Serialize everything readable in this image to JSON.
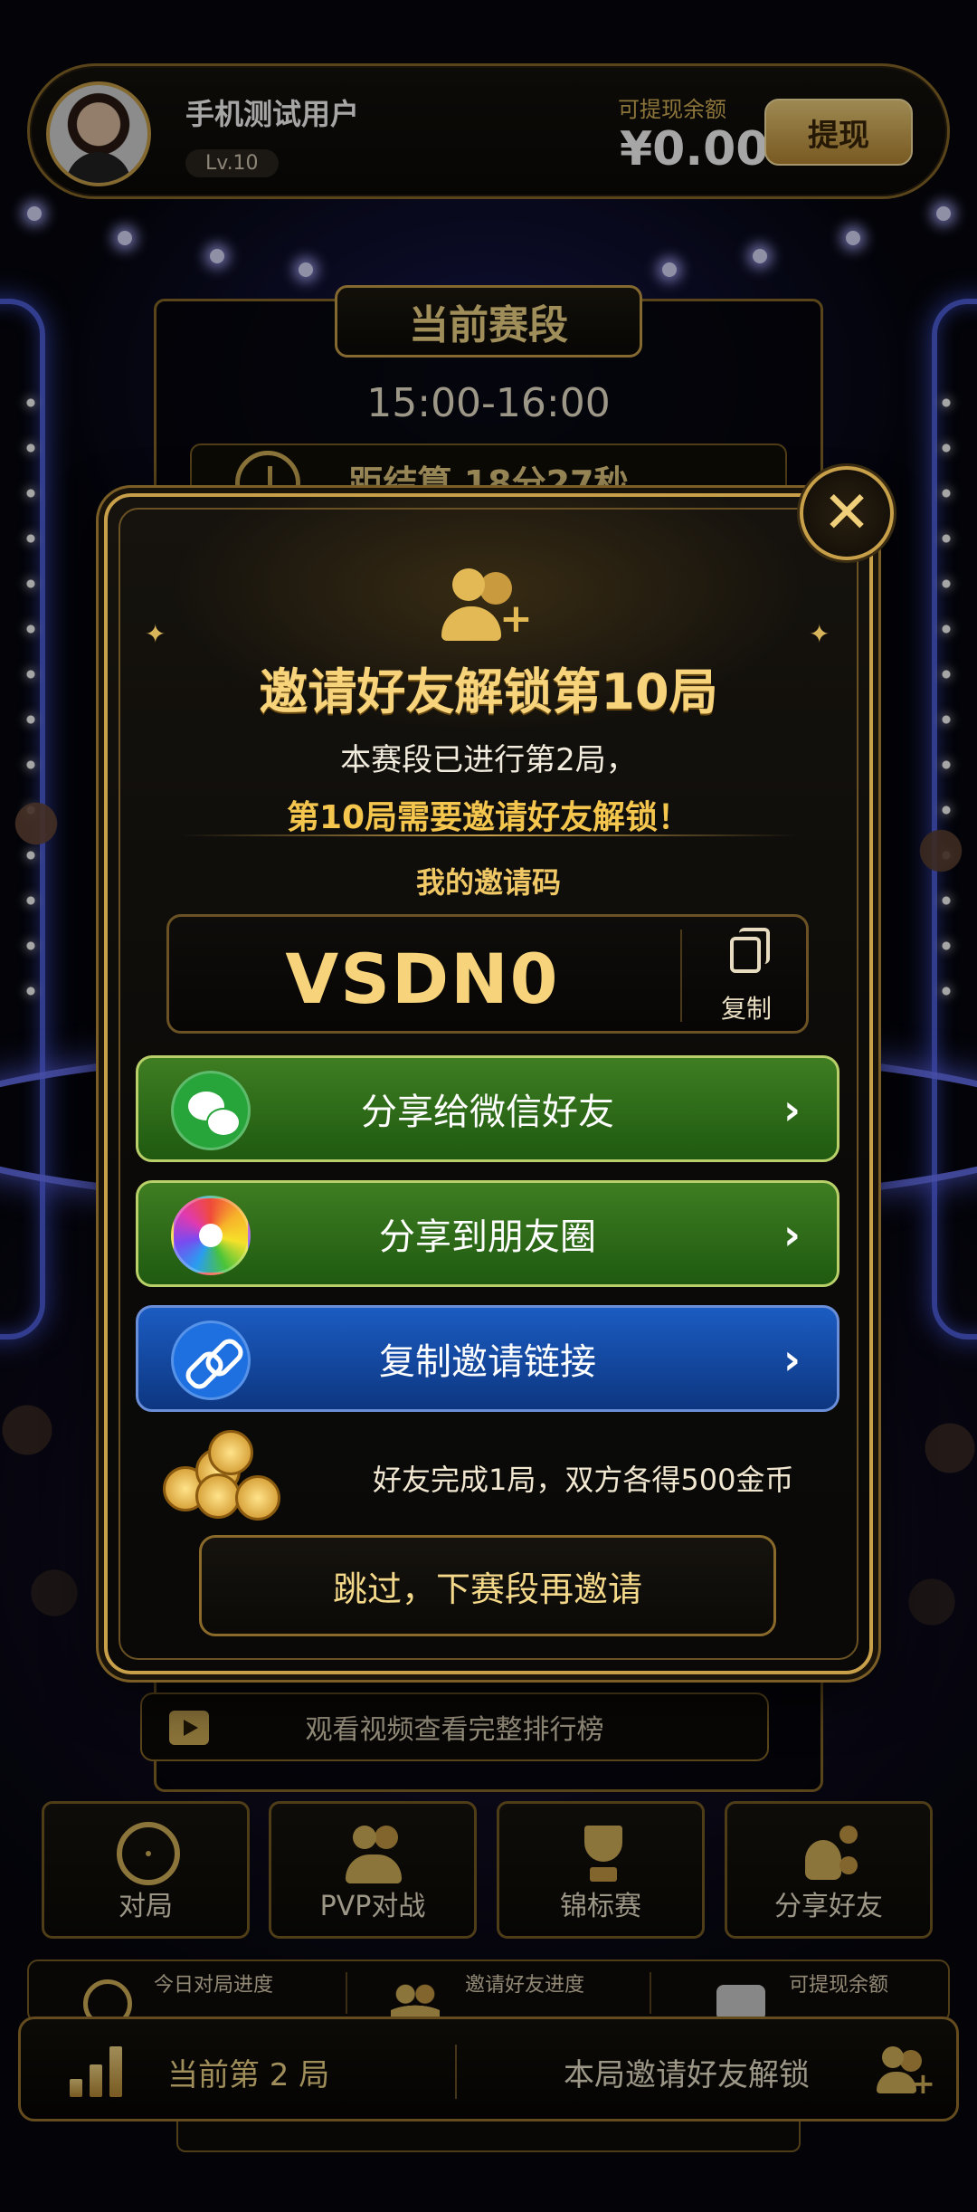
{
  "user": {
    "name": "手机测试用户",
    "level": "Lv.10"
  },
  "balance": {
    "label": "可提现余额",
    "value": "¥0.00",
    "withdraw_label": "提现"
  },
  "section": {
    "title": "当前赛段",
    "time": "15:00-16:00",
    "countdown": "距结算 18分27秒",
    "watch_label": "观看视频查看完整排行榜"
  },
  "nav": [
    {
      "label": "对局",
      "icon": "target-icon"
    },
    {
      "label": "PVP对战",
      "icon": "people-icon"
    },
    {
      "label": "锦标赛",
      "icon": "trophy-icon"
    },
    {
      "label": "分享好友",
      "icon": "share-friends-icon"
    }
  ],
  "progress": [
    {
      "label": "今日对局进度"
    },
    {
      "label": "邀请好友进度"
    },
    {
      "label": "可提现余额"
    }
  ],
  "bottom_bar": {
    "round_text": "当前第 2 局",
    "unlock_text": "本局邀请好友解锁"
  },
  "modal": {
    "title": "邀请好友解锁第10局",
    "sub1": "本赛段已进行第2局，",
    "sub2": "第10局需要邀请好友解锁！",
    "code_label": "我的邀请码",
    "code": "VSDN0",
    "copy_label": "复制",
    "share_wechat": "分享给微信好友",
    "share_moments": "分享到朋友圈",
    "copy_link": "复制邀请链接",
    "reward_text": "好友完成1局，双方各得500金币",
    "skip_label": "跳过，下赛段再邀请",
    "close_symbol": "✕"
  },
  "colors": {
    "gold": "#f7d47c",
    "accent_gold": "#c9a04a",
    "wechat_green": "#3f7d22",
    "link_blue": "#1b5cc2"
  }
}
